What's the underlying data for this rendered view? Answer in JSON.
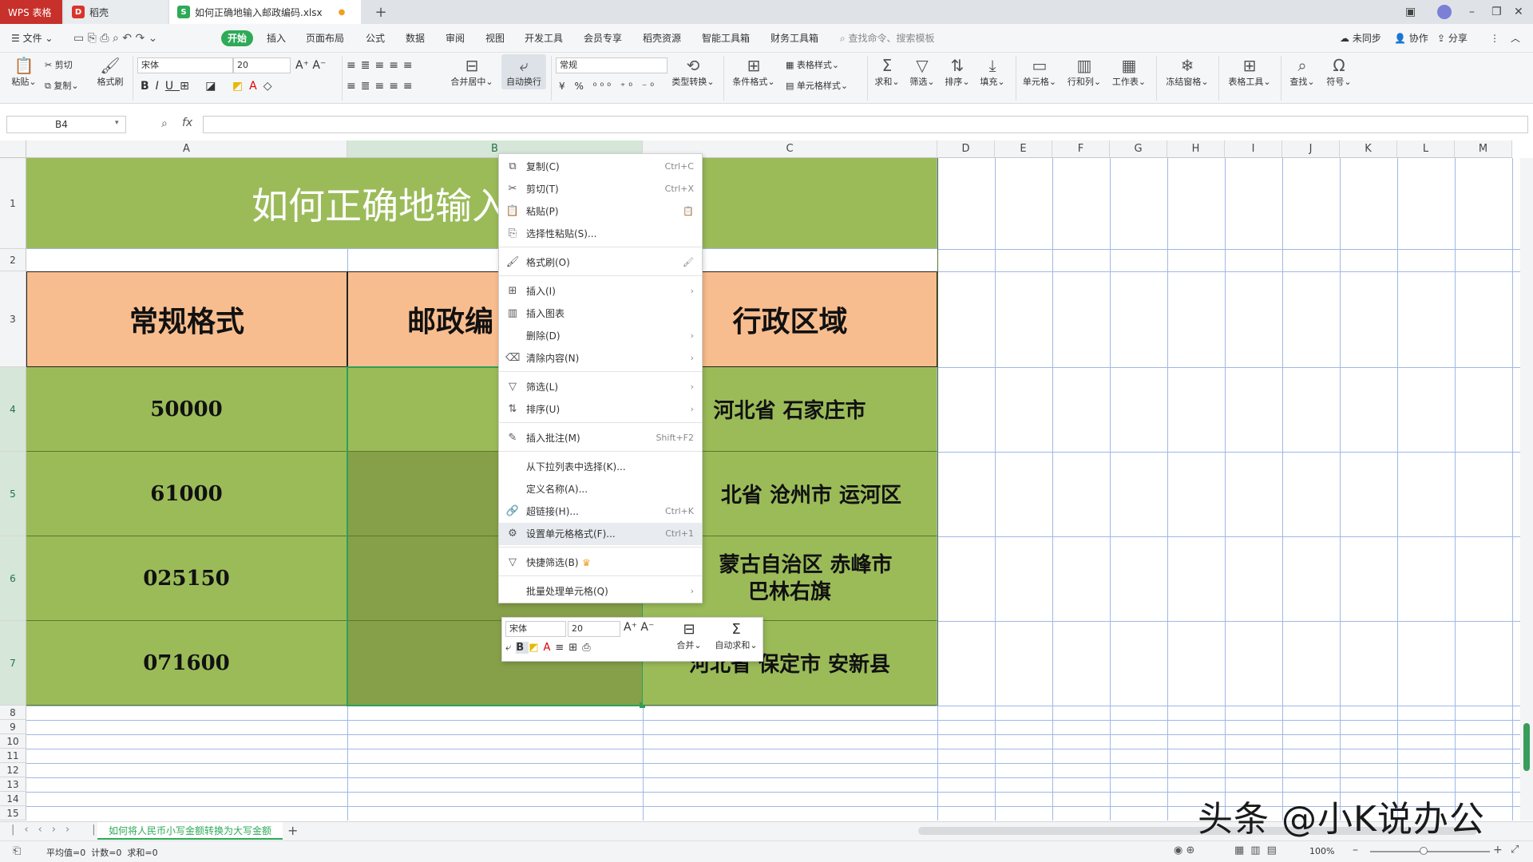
{
  "titlebar": {
    "app_tab": "WPS 表格",
    "daoke_tab": "稻壳",
    "file_tab": "如何正确地输入邮政编码.xlsx",
    "add_tab": "+"
  },
  "menubar": {
    "file": "文件",
    "items": [
      "开始",
      "插入",
      "页面布局",
      "公式",
      "数据",
      "审阅",
      "视图",
      "开发工具",
      "会员专享",
      "稻壳资源",
      "智能工具箱",
      "财务工具箱"
    ],
    "search": "查找命令、搜索模板",
    "sync": "未同步",
    "collab": "协作",
    "share": "分享"
  },
  "ribbon": {
    "paste": "粘贴",
    "cut": "剪切",
    "copy": "复制",
    "format_painter": "格式刷",
    "font_name": "宋体",
    "font_size": "20",
    "merge_center": "合并居中",
    "auto_wrap": "自动换行",
    "number_format": "常规",
    "type_convert": "类型转换",
    "cond_format": "条件格式",
    "table_style": "表格样式",
    "cell_style": "单元格样式",
    "sum": "求和",
    "filter": "筛选",
    "sort": "排序",
    "fill": "填充",
    "cell": "单元格",
    "row_col": "行和列",
    "worksheet": "工作表",
    "freeze": "冻结窗格",
    "table_tools": "表格工具",
    "find": "查找",
    "symbol": "符号"
  },
  "formulabar": {
    "cell_ref": "B4",
    "fx": "fx",
    "value": ""
  },
  "columns": [
    "A",
    "B",
    "C",
    "D",
    "E",
    "F",
    "G",
    "H",
    "I",
    "J",
    "K",
    "L",
    "M"
  ],
  "rows": [
    "1",
    "2",
    "3",
    "4",
    "5",
    "6",
    "7",
    "8",
    "9",
    "10",
    "11",
    "12",
    "13",
    "14",
    "15"
  ],
  "sheet": {
    "title": "如何正确地输入",
    "headers": [
      "常规格式",
      "邮政编",
      "行政区域"
    ],
    "col_a": [
      "50000",
      "61000",
      "025150",
      "071600"
    ],
    "col_c": [
      "河北省  石家庄市",
      "北省  沧州市  运河区",
      "蒙古自治区  赤峰市",
      "巴林右旗",
      "河北省  保定市  安新县"
    ]
  },
  "context_menu": [
    {
      "icon": "⧉",
      "label": "复制(C)",
      "shortcut": "Ctrl+C"
    },
    {
      "icon": "✂",
      "label": "剪切(T)",
      "shortcut": "Ctrl+X"
    },
    {
      "icon": "📋",
      "label": "粘贴(P)",
      "shortcut": ""
    },
    {
      "icon": "⎘",
      "label": "选择性粘贴(S)...",
      "shortcut": ""
    },
    {
      "icon": "🖌",
      "label": "格式刷(O)",
      "shortcut": ""
    },
    {
      "icon": "⊞",
      "label": "插入(I)",
      "shortcut": "›"
    },
    {
      "icon": "▥",
      "label": "插入图表",
      "shortcut": ""
    },
    {
      "icon": "",
      "label": "删除(D)",
      "shortcut": "›"
    },
    {
      "icon": "⌫",
      "label": "清除内容(N)",
      "shortcut": "›"
    },
    {
      "icon": "▽",
      "label": "筛选(L)",
      "shortcut": "›"
    },
    {
      "icon": "⇅",
      "label": "排序(U)",
      "shortcut": "›"
    },
    {
      "icon": "✎",
      "label": "插入批注(M)",
      "shortcut": "Shift+F2"
    },
    {
      "icon": "",
      "label": "从下拉列表中选择(K)...",
      "shortcut": ""
    },
    {
      "icon": "",
      "label": "定义名称(A)...",
      "shortcut": ""
    },
    {
      "icon": "🔗",
      "label": "超链接(H)...",
      "shortcut": "Ctrl+K"
    },
    {
      "icon": "⚙",
      "label": "设置单元格格式(F)...",
      "shortcut": "Ctrl+1"
    },
    {
      "icon": "▽",
      "label": "快捷筛选(B)",
      "shortcut": ""
    },
    {
      "icon": "",
      "label": "批量处理单元格(Q)",
      "shortcut": "›"
    }
  ],
  "minibar": {
    "font_name": "宋体",
    "font_size": "20",
    "merge": "合并",
    "autosum": "自动求和"
  },
  "sheetbar": {
    "sheet_tab": "如何将人民币小写金额转换为大写金额",
    "add": "+"
  },
  "statusbar": {
    "stats": "平均值=0  计数=0  求和=0",
    "zoom": "100%"
  },
  "watermark": "头条 @小K说办公",
  "colors": {
    "wps_red": "#c8302b",
    "accent_green": "#2eaa58",
    "cell_green": "#9bbb59",
    "cell_dark_green": "#86a049",
    "header_orange": "#f8bd8e"
  }
}
